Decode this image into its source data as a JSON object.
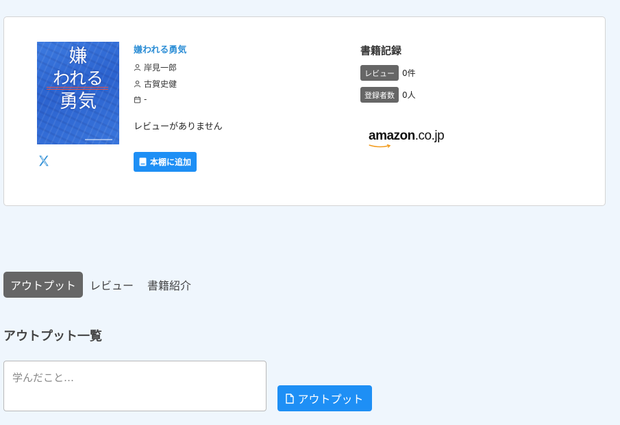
{
  "book": {
    "title": "嫌われる勇気",
    "author1": "岸見一郎",
    "author2": "古賀史健",
    "date": "-",
    "review_status": "レビューがありません",
    "add_shelf_label": "本棚に追加",
    "cover_text": [
      "嫌",
      "われる",
      "勇気"
    ]
  },
  "record": {
    "title": "書籍記録",
    "review_badge": "レビュー",
    "review_count": "0件",
    "registered_badge": "登録者数",
    "registered_count": "0人"
  },
  "amazon": {
    "word": "amazon",
    "tld": ".co.jp"
  },
  "tabs": [
    {
      "label": "アウトプット",
      "active": true
    },
    {
      "label": "レビュー",
      "active": false
    },
    {
      "label": "書籍紹介",
      "active": false
    }
  ],
  "output": {
    "section_title": "アウトプット一覧",
    "placeholder": "学んだこと…",
    "button_label": "アウトプット"
  },
  "colors": {
    "accent": "#1e8ff5",
    "link": "#2f8fd6",
    "badge": "#666666",
    "background": "#eff6fd"
  }
}
